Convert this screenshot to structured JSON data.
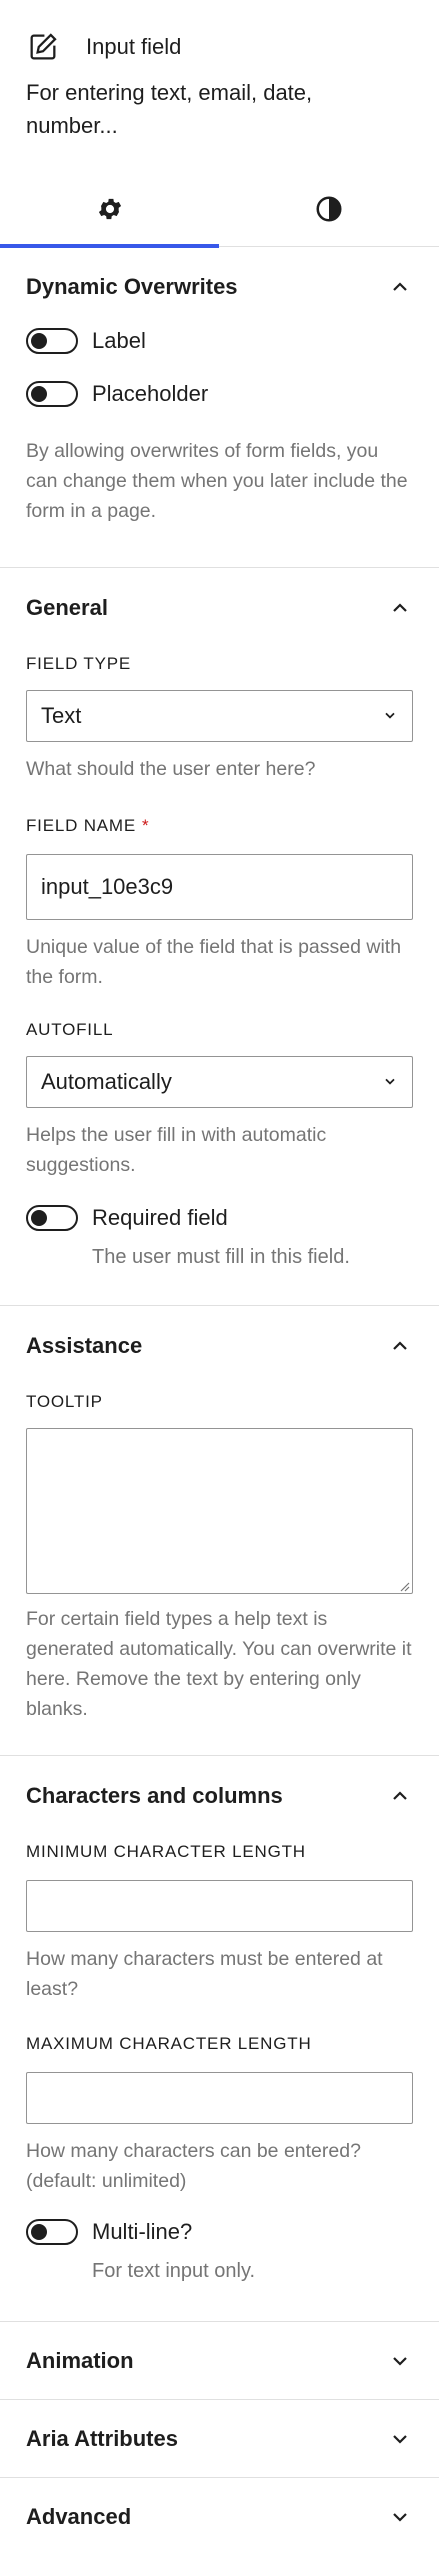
{
  "header": {
    "icon": "edit-square-icon",
    "title": "Input field",
    "description": "For entering text, email, date, number..."
  },
  "tabs": [
    {
      "icon": "gear-icon",
      "active": true
    },
    {
      "icon": "contrast-icon",
      "active": false
    }
  ],
  "dynamic_overwrites": {
    "title": "Dynamic Overwrites",
    "toggles": [
      {
        "label": "Label",
        "checked": false
      },
      {
        "label": "Placeholder",
        "checked": false
      }
    ],
    "help": "By allowing overwrites of form fields, you can change them when you later include the form in a page."
  },
  "general": {
    "title": "General",
    "field_type": {
      "label": "FIELD TYPE",
      "value": "Text",
      "help": "What should the user enter here?"
    },
    "field_name": {
      "label": "FIELD NAME",
      "required_mark": "*",
      "value": "input_10e3c9",
      "help": "Unique value of the field that is passed with the form."
    },
    "autofill": {
      "label": "AUTOFILL",
      "value": "Automatically",
      "help": "Helps the user fill in with automatic suggestions."
    },
    "required": {
      "label": "Required field",
      "help": "The user must fill in this field.",
      "checked": false
    }
  },
  "assistance": {
    "title": "Assistance",
    "tooltip": {
      "label": "TOOLTIP",
      "value": "",
      "help": "For certain field types a help text is generated automatically. You can overwrite it here. Remove the text by entering only blanks."
    }
  },
  "characters": {
    "title": "Characters and columns",
    "min": {
      "label": "MINIMUM CHARACTER LENGTH",
      "value": "",
      "help": "How many characters must be entered at least?"
    },
    "max": {
      "label": "MAXIMUM CHARACTER LENGTH",
      "value": "",
      "help": "How many characters can be entered? (default: unlimited)"
    },
    "multiline": {
      "label": "Multi-line?",
      "help": "For text input only.",
      "checked": false
    }
  },
  "collapsed_panels": [
    {
      "title": "Animation"
    },
    {
      "title": "Aria Attributes"
    },
    {
      "title": "Advanced"
    }
  ],
  "colors": {
    "accent": "#3858e9",
    "required": "#cc1818",
    "muted": "#757575",
    "border": "#e0e0e0"
  }
}
